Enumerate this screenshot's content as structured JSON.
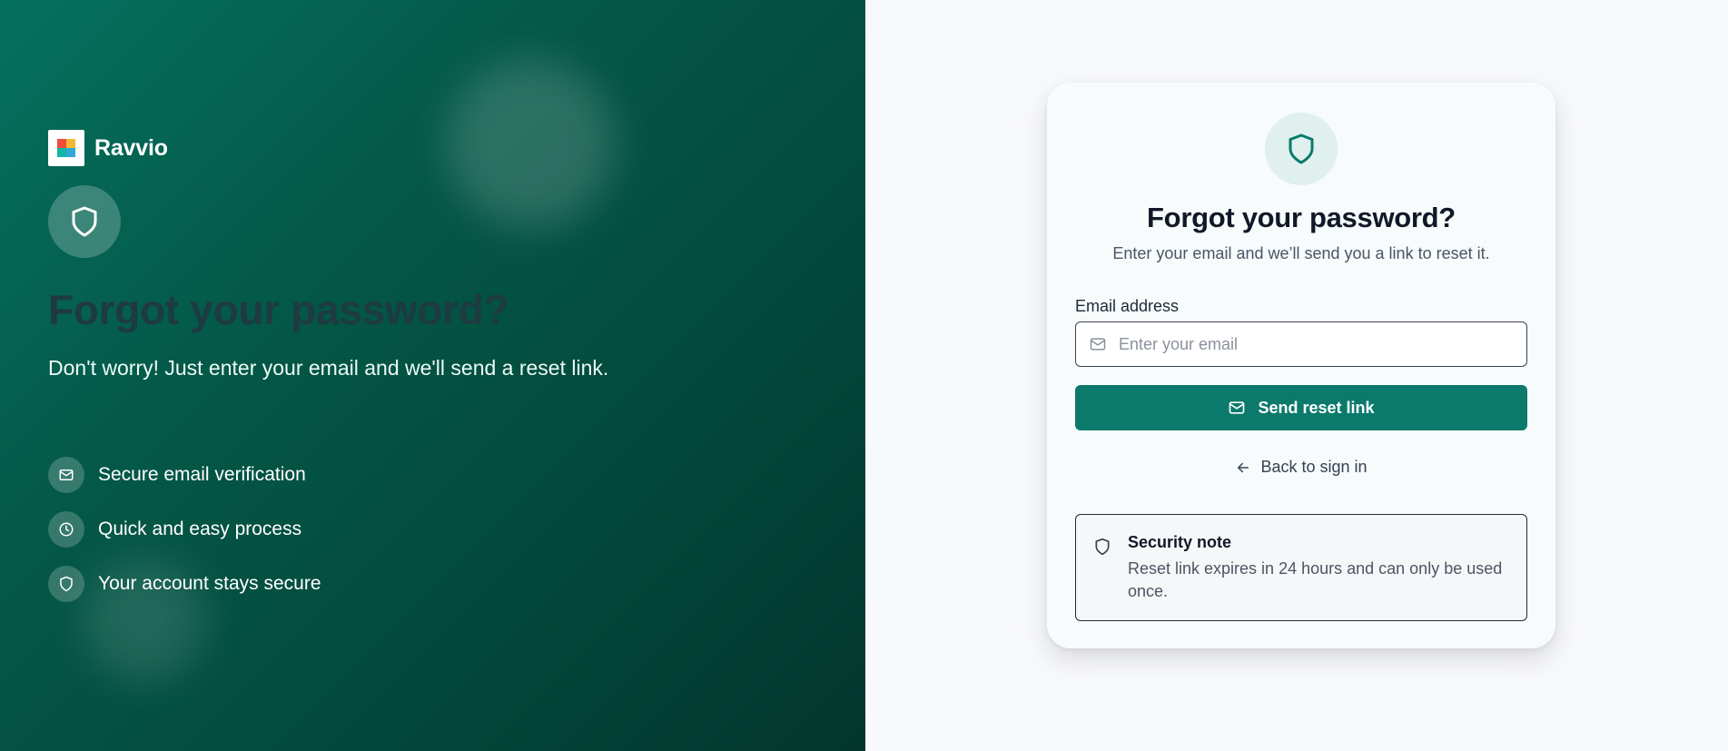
{
  "brand": {
    "name": "Ravvio"
  },
  "hero": {
    "title": "Forgot your password?",
    "subtitle": "Don't worry! Just enter your email and we'll send a reset link.",
    "features": [
      {
        "icon": "mail-icon",
        "label": "Secure email verification"
      },
      {
        "icon": "clock-icon",
        "label": "Quick and easy process"
      },
      {
        "icon": "shield-icon",
        "label": "Your account stays secure"
      }
    ]
  },
  "card": {
    "title": "Forgot your password?",
    "subtitle": "Enter your email and we’ll send you a link to reset it.",
    "email": {
      "label": "Email address",
      "placeholder": "Enter your email",
      "value": ""
    },
    "submit_label": "Send reset link",
    "back_label": "Back to sign in",
    "note": {
      "title": "Security note",
      "body": "Reset link expires in 24 hours and can only be used once."
    }
  },
  "colors": {
    "hero_gradient_start": "#06705f",
    "hero_gradient_end": "#02362d",
    "accent": "#0b7a6c",
    "accent_soft": "#dff0ee",
    "page_background": "#f8f9fb"
  }
}
